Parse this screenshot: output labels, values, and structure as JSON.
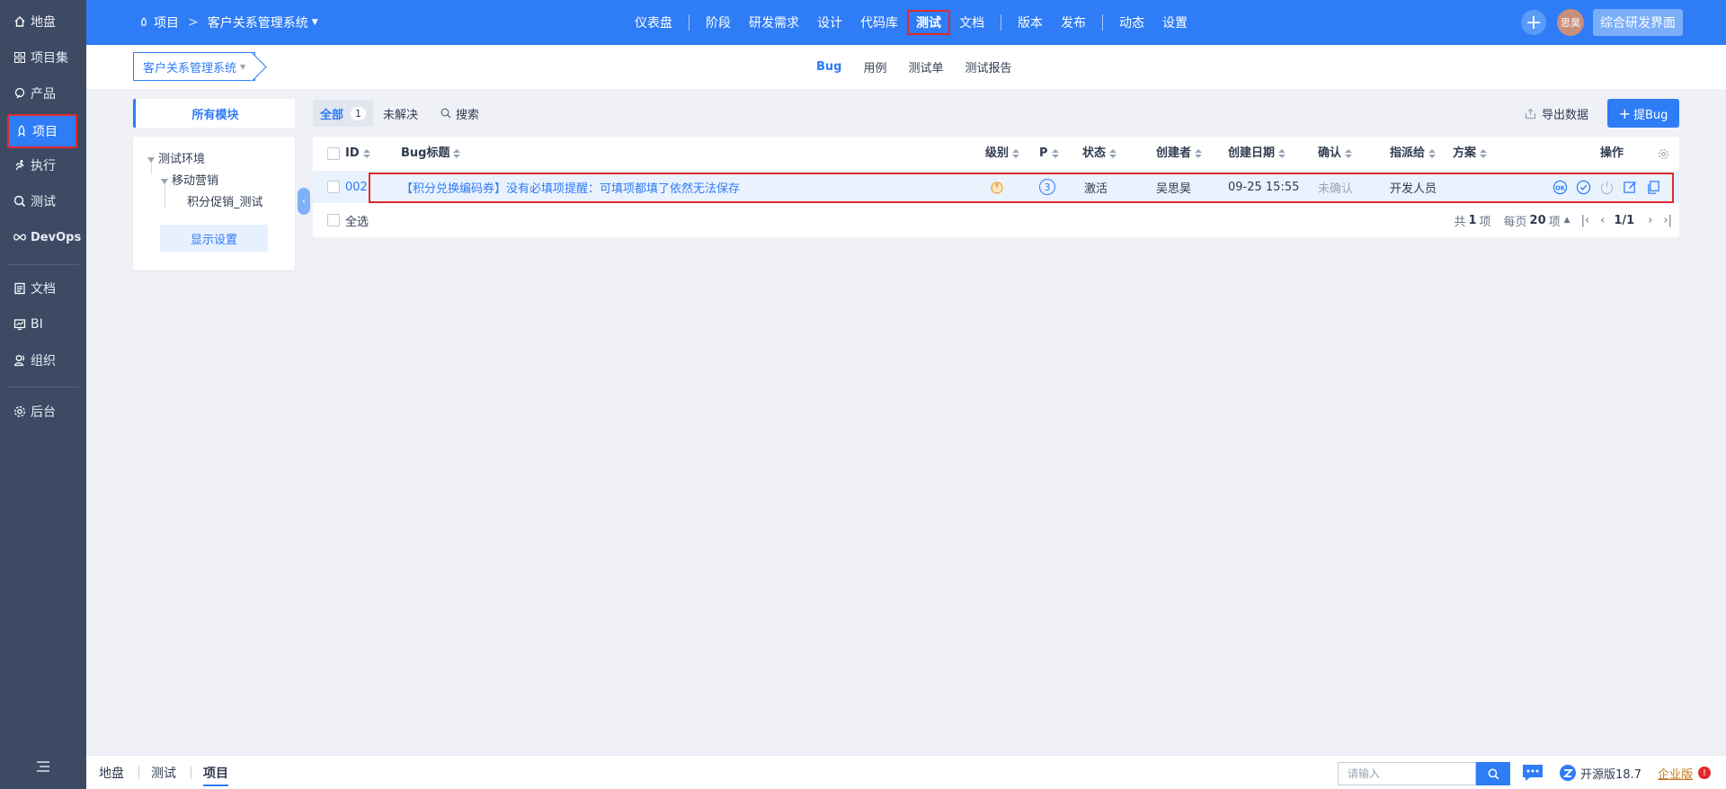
{
  "leftnav": {
    "items": [
      {
        "label": "地盘",
        "icon": "home-icon"
      },
      {
        "label": "项目集",
        "icon": "grid-icon"
      },
      {
        "label": "产品",
        "icon": "product-icon"
      },
      {
        "label": "项目",
        "icon": "rocket-icon"
      },
      {
        "label": "执行",
        "icon": "run-icon"
      },
      {
        "label": "测试",
        "icon": "test-icon"
      },
      {
        "label": "DevOps",
        "icon": "infinity-icon"
      },
      {
        "label": "文档",
        "icon": "doc-icon"
      },
      {
        "label": "BI",
        "icon": "bi-icon"
      },
      {
        "label": "组织",
        "icon": "org-icon"
      },
      {
        "label": "后台",
        "icon": "gear-icon"
      }
    ]
  },
  "topbar": {
    "crumb_root": "项目",
    "crumb_project": "客户关系管理系统",
    "nav": [
      "仪表盘",
      "阶段",
      "研发需求",
      "设计",
      "代码库",
      "测试",
      "文档",
      "版本",
      "发布",
      "动态",
      "设置"
    ],
    "active_nav": "测试",
    "avatar_text": "思昊",
    "rd_button": "综合研发界面"
  },
  "subbar": {
    "project_select": "客户关系管理系统",
    "tabs": [
      "Bug",
      "用例",
      "测试单",
      "测试报告"
    ],
    "active_tab": "Bug"
  },
  "modules": {
    "header": "所有模块",
    "tree": [
      "测试环境",
      "移动营销",
      "积分促销_测试"
    ],
    "display_settings": "显示设置"
  },
  "toolbar": {
    "all_label": "全部",
    "all_count": "1",
    "unresolved": "未解决",
    "search": "搜索",
    "export": "导出数据",
    "add_bug": "提Bug"
  },
  "table": {
    "columns": [
      "ID",
      "Bug标题",
      "级别",
      "P",
      "状态",
      "创建者",
      "创建日期",
      "确认",
      "指派给",
      "方案",
      "操作"
    ],
    "rows": [
      {
        "id": "002",
        "title": "【积分兑换编码券】没有必填项提醒：可填项都填了依然无法保存",
        "severity_icon": "severity-icon",
        "priority": "3",
        "status": "激活",
        "creator": "吴思昊",
        "created": "09-25 15:55",
        "confirmed": "未确认",
        "assigned": "开发人员",
        "solution": ""
      }
    ],
    "select_all": "全选",
    "pager": {
      "total_prefix": "共",
      "total": "1",
      "total_suffix": "项",
      "per_prefix": "每页",
      "per": "20",
      "per_suffix": "项",
      "page": "1/1"
    }
  },
  "bottombar": {
    "crumbs": [
      "地盘",
      "测试",
      "项目"
    ],
    "active_crumb": "项目",
    "search_placeholder": "请输入",
    "version": "开源版18.7",
    "enterprise": "企业版"
  },
  "colors": {
    "primary": "#2e7cf6",
    "nav_bg": "#3c4a64",
    "highlight": "#e4292e"
  }
}
